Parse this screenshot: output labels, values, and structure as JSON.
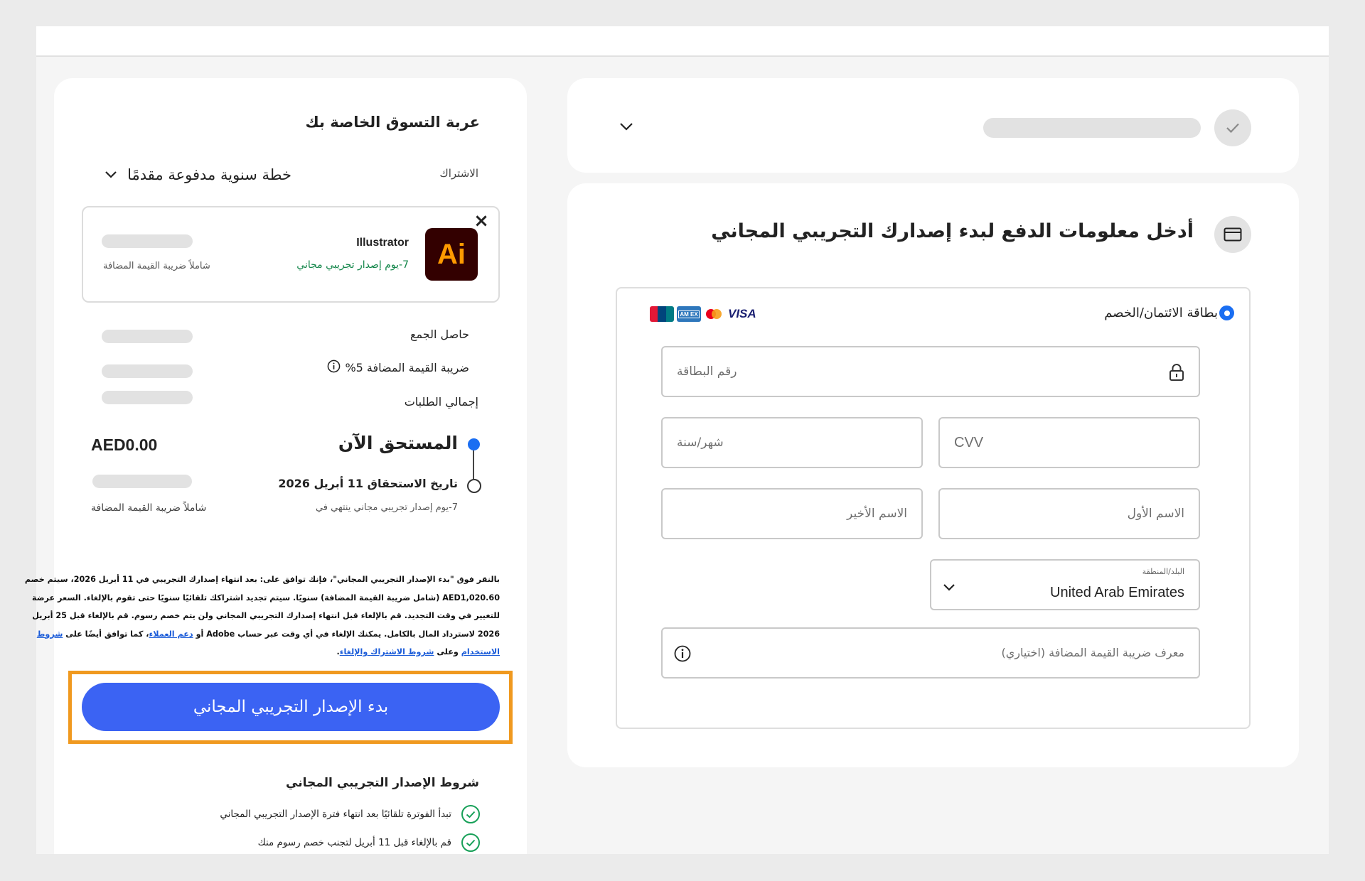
{
  "cart": {
    "title": "عربة التسوق الخاصة بك",
    "subscription_label": "الاشتراك",
    "plan_selected": "خطة سنوية مدفوعة مقدمًا",
    "product": {
      "icon_text": "Ai",
      "name": "Illustrator",
      "trial_text": "7-يوم إصدار تجريبي مجاني",
      "vat_note": "شاملاً ضريبة القيمة المضافة",
      "remove_symbol": "×"
    },
    "subtotal_label": "حاصل الجمع",
    "vat_label": "ضريبة القيمة المضافة 5%",
    "order_total_label": "إجمالي الطلبات",
    "due_now_label": "المستحق الآن",
    "due_now_amount": "AED0.00",
    "due_date_label": "تاريخ الاستحقاق 11 أبريل 2026",
    "trial_ends_text": "7-يوم إصدار تجريبي مجاني ينتهي في",
    "incl_vat": "شاملاً ضريبة القيمة المضافة",
    "legal": {
      "line1": "بالنقر فوق \"بدء الإصدار التجريبي المجاني\"، فإنك توافق على: بعد انتهاء إصدارك التجريبي في 11 أبريل 2026، سيتم خصم",
      "line2": "AED1,020.60 (شامل ضريبة القيمة المضافة) سنويًا. سيتم تجديد اشتراكك تلقائيًا سنويًا حتى تقوم بالإلغاء. السعر عرضة",
      "line3": "للتغيير في وقت التجديد. قم بالإلغاء قبل انتهاء إصدارك التجريبي المجاني ولن يتم خصم رسوم. قم بالإلغاء قبل 25 أبريل",
      "line4_a": "2026 لاسترداد المال بالكامل. يمكنك الإلغاء في أي وقت عبر حساب Adobe أو",
      "link_support": "دعم العملاء",
      "line4_b": "، كما توافق أيضًا على",
      "link_terms_1": "شروط",
      "link_terms_2": "الاستخدام",
      "line5_b": "وعلى",
      "link_cancel": "شروط الاشتراك والإلغاء",
      "line5_end": "."
    },
    "start_trial_button": "بدء الإصدار التجريبي المجاني",
    "trial_terms_title": "شروط الإصدار التجريبي المجاني",
    "trial_terms": [
      "تبدأ الفوترة تلقائيًا بعد انتهاء فترة الإصدار التجريبي المجاني",
      "قم بالإلغاء قبل 11 أبريل لتجنب خصم رسوم منك"
    ]
  },
  "payment": {
    "title": "أدخل معلومات الدفع لبدء إصدارك التجريبي المجاني",
    "method_label": "بطاقة الائتمان/الخصم",
    "card_brands": [
      "UnionPay",
      "AMEX",
      "Mastercard",
      "VISA"
    ],
    "card_number_placeholder": "رقم البطاقة",
    "expiry_placeholder": "شهر/سنة",
    "cvv_placeholder": "CVV",
    "last_name_placeholder": "الاسم الأخير",
    "first_name_placeholder": "الاسم الأول",
    "country_label": "البلد/المنطقة",
    "country_value": "United Arab Emirates",
    "vat_id_placeholder": "معرف ضريبة القيمة المضافة (اختياري)"
  },
  "colors": {
    "accent_blue": "#3b63f3",
    "highlight_orange": "#f0991f",
    "trial_green": "#13864a",
    "illustrator_bg": "#330000",
    "illustrator_fg": "#ff9a00"
  }
}
